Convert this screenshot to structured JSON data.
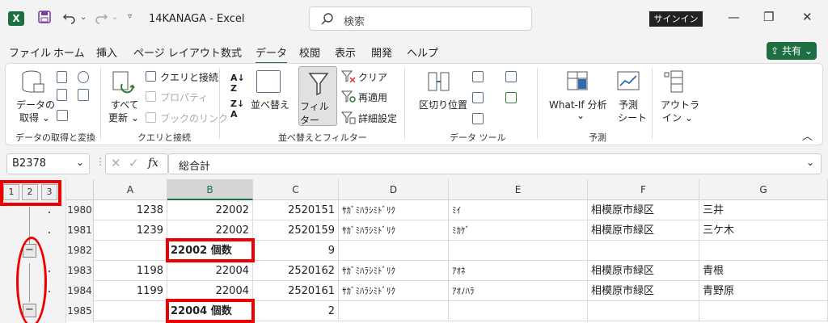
{
  "titlebar": {
    "app_logo": "X",
    "file_title": "14KANAGA  -  Excel",
    "search_placeholder": "検索",
    "signin_label": "サインイン",
    "icons": [
      "save-icon",
      "undo-icon",
      "redo-icon",
      "customize-icon",
      "search-icon",
      "minimize-icon",
      "restore-icon",
      "close-icon"
    ]
  },
  "menu": {
    "tabs": [
      "ファイル",
      "ホーム",
      "挿入",
      "ページ レイアウト",
      "数式",
      "データ",
      "校閲",
      "表示",
      "開発",
      "ヘルプ"
    ],
    "active_tab": "データ",
    "share_label": "共有"
  },
  "ribbon": {
    "get_data": {
      "label_line1": "データの",
      "label_line2": "取得"
    },
    "refresh_all": {
      "label_line1": "すべて",
      "label_line2": "更新"
    },
    "queries_connections": "クエリと接続",
    "properties": "プロパティ",
    "edit_links": "ブックのリンク",
    "sort": "並べ替え",
    "filter": "フィルター",
    "clear": "クリア",
    "reapply": "再適用",
    "advanced": "詳細設定",
    "text_to_columns": "区切り位置",
    "what_if": "What-If 分析",
    "forecast_sheet": {
      "line1": "予測",
      "line2": "シート"
    },
    "outline": {
      "line1": "アウトラ",
      "line2": "イン"
    },
    "groups": {
      "get_transform": "データの取得と変換",
      "queries": "クエリと接続",
      "sort_filter": "並べ替えとフィルター",
      "data_tools": "データ ツール",
      "forecast": "予測"
    }
  },
  "formula_bar": {
    "name_box": "B2378",
    "formula": "総合計"
  },
  "outline_levels": [
    "1",
    "2",
    "3"
  ],
  "columns": [
    "A",
    "B",
    "C",
    "D",
    "E",
    "F",
    "G"
  ],
  "rows": [
    {
      "num": "1980",
      "A": "1238",
      "B": "22002",
      "C": "2520151",
      "D": "ｻｶﾞﾐﾊﾗｼﾐﾄﾞﾘｸ",
      "E": "ﾐｲ",
      "F": "相模原市緑区",
      "G": "三井"
    },
    {
      "num": "1981",
      "A": "1239",
      "B": "22002",
      "C": "2520159",
      "D": "ｻｶﾞﾐﾊﾗｼﾐﾄﾞﾘｸ",
      "E": "ﾐｶｹﾞ",
      "F": "相模原市緑区",
      "G": "三ケ木"
    },
    {
      "num": "1982",
      "A": "",
      "B": "22002 個数",
      "C": "9",
      "D": "",
      "E": "",
      "F": "",
      "G": ""
    },
    {
      "num": "1983",
      "A": "1198",
      "B": "22004",
      "C": "2520162",
      "D": "ｻｶﾞﾐﾊﾗｼﾐﾄﾞﾘｸ",
      "E": "ｱｵﾈ",
      "F": "相模原市緑区",
      "G": "青根"
    },
    {
      "num": "1984",
      "A": "1199",
      "B": "22004",
      "C": "2520161",
      "D": "ｻｶﾞﾐﾊﾗｼﾐﾄﾞﾘｸ",
      "E": "ｱｵﾉﾊﾗ",
      "F": "相模原市緑区",
      "G": "青野原"
    },
    {
      "num": "1985",
      "A": "",
      "B": "22004 個数",
      "C": "2",
      "D": "",
      "E": "",
      "F": "",
      "G": ""
    }
  ],
  "colors": {
    "accent": "#1d6f42",
    "annotation": "#ee0000"
  }
}
